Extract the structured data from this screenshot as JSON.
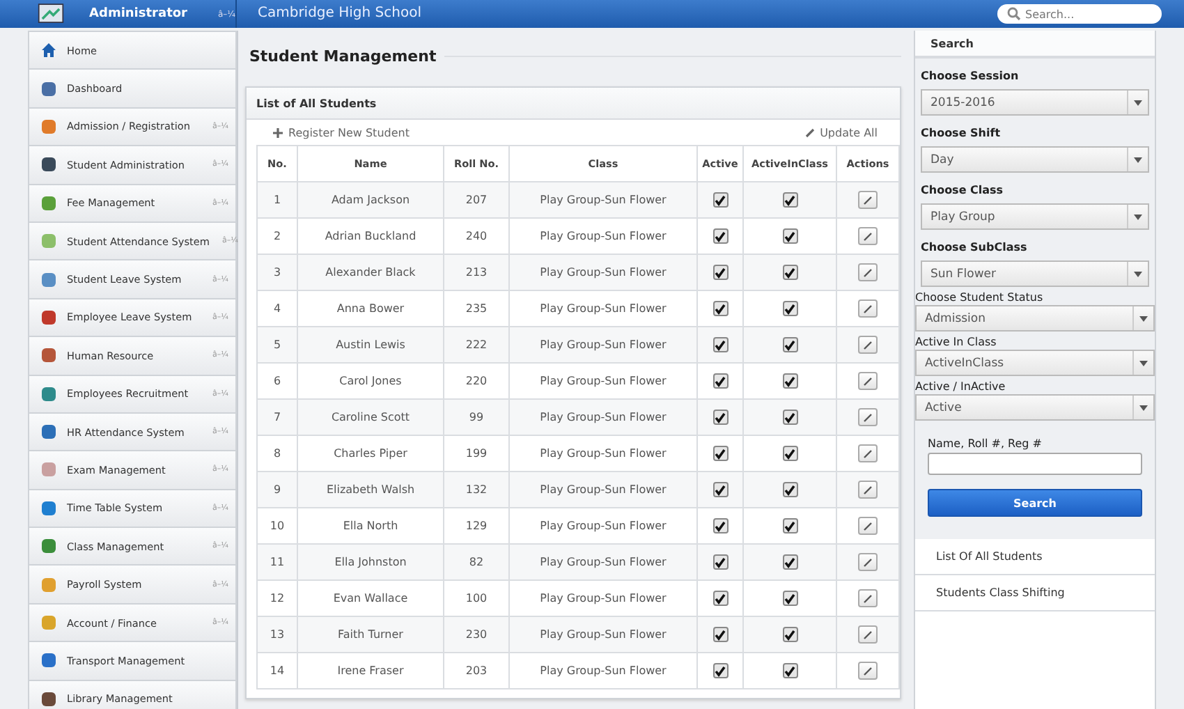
{
  "header": {
    "user": "Administrator",
    "user_caret": "â–¼",
    "school": "Cambridge High School",
    "search_placeholder": "Search..."
  },
  "sidebar": {
    "items": [
      {
        "label": "Home",
        "selected": false
      },
      {
        "label": "Dashboard",
        "selected": false
      },
      {
        "label": "Admission / Registration",
        "caret": "â–¼",
        "selected": false
      },
      {
        "label": "Student Administration",
        "caret": "â–¼",
        "selected": false
      },
      {
        "label": "Fee Management",
        "caret": "â–¼",
        "selected": false
      },
      {
        "label": "Student Attendance System",
        "caret": "â–¼",
        "selected": false
      },
      {
        "label": "Student Leave System",
        "caret": "â–¼",
        "selected": false
      },
      {
        "label": "Employee Leave System",
        "caret": "â–¼",
        "selected": false
      },
      {
        "label": "Human Resource",
        "caret": "â–¼",
        "selected": false
      },
      {
        "label": "Employees Recruitment",
        "caret": "â–¼",
        "selected": false
      },
      {
        "label": "HR Attendance System",
        "caret": "â–¼",
        "selected": false
      },
      {
        "label": "Exam Management",
        "caret": "â–¼",
        "selected": false
      },
      {
        "label": "Time Table System",
        "caret": "â–¼",
        "selected": false
      },
      {
        "label": "Class Management",
        "caret": "â–¼",
        "selected": false
      },
      {
        "label": "Payroll System",
        "caret": "â–¼",
        "selected": false
      },
      {
        "label": "Account / Finance",
        "caret": "â–¼",
        "selected": false
      },
      {
        "label": "Transport Management",
        "selected": false
      },
      {
        "label": "Library Management",
        "selected": false
      }
    ]
  },
  "page_title": "Student Management",
  "panel": {
    "title": "List of All Students",
    "register": "Register New Student",
    "update_all": "Update All",
    "table": {
      "columns": [
        "No.",
        "Name",
        "Roll No.",
        "Class",
        "Active",
        "ActiveInClass",
        "Actions"
      ],
      "rows": [
        {
          "no": "1",
          "name": "Adam Jackson",
          "roll": "207",
          "class": "Play Group-Sun Flower",
          "active": true,
          "active_in_class": true
        },
        {
          "no": "2",
          "name": "Adrian Buckland",
          "roll": "240",
          "class": "Play Group-Sun Flower",
          "active": true,
          "active_in_class": true
        },
        {
          "no": "3",
          "name": "Alexander Black",
          "roll": "213",
          "class": "Play Group-Sun Flower",
          "active": true,
          "active_in_class": true
        },
        {
          "no": "4",
          "name": "Anna Bower",
          "roll": "235",
          "class": "Play Group-Sun Flower",
          "active": true,
          "active_in_class": true
        },
        {
          "no": "5",
          "name": "Austin Lewis",
          "roll": "222",
          "class": "Play Group-Sun Flower",
          "active": true,
          "active_in_class": true
        },
        {
          "no": "6",
          "name": "Carol Jones",
          "roll": "220",
          "class": "Play Group-Sun Flower",
          "active": true,
          "active_in_class": true
        },
        {
          "no": "7",
          "name": "Caroline Scott",
          "roll": "99",
          "class": "Play Group-Sun Flower",
          "active": true,
          "active_in_class": true
        },
        {
          "no": "8",
          "name": "Charles Piper",
          "roll": "199",
          "class": "Play Group-Sun Flower",
          "active": true,
          "active_in_class": true
        },
        {
          "no": "9",
          "name": "Elizabeth Walsh",
          "roll": "132",
          "class": "Play Group-Sun Flower",
          "active": true,
          "active_in_class": true
        },
        {
          "no": "10",
          "name": "Ella North",
          "roll": "129",
          "class": "Play Group-Sun Flower",
          "active": true,
          "active_in_class": true
        },
        {
          "no": "11",
          "name": "Ella Johnston",
          "roll": "82",
          "class": "Play Group-Sun Flower",
          "active": true,
          "active_in_class": true
        },
        {
          "no": "12",
          "name": "Evan Wallace",
          "roll": "100",
          "class": "Play Group-Sun Flower",
          "active": true,
          "active_in_class": true
        },
        {
          "no": "13",
          "name": "Faith Turner",
          "roll": "230",
          "class": "Play Group-Sun Flower",
          "active": true,
          "active_in_class": true
        },
        {
          "no": "14",
          "name": "Irene Fraser",
          "roll": "203",
          "class": "Play Group-Sun Flower",
          "active": true,
          "active_in_class": true
        }
      ]
    }
  },
  "search_panel": {
    "title": "Search",
    "filters": [
      {
        "label": "Choose Session",
        "value": "2015-2016",
        "kind": "inset"
      },
      {
        "label": "Choose Shift",
        "value": "Day",
        "kind": "inset"
      },
      {
        "label": "Choose Class",
        "value": "Play Group",
        "kind": "inset"
      },
      {
        "label": "Choose SubClass",
        "value": "Sun Flower",
        "kind": "inset"
      },
      {
        "label": "Choose Student Status",
        "value": "Admission",
        "kind": "wide"
      },
      {
        "label": "Active In Class",
        "value": "ActiveInClass",
        "kind": "wide"
      },
      {
        "label": "Active / InActive",
        "value": "Active",
        "kind": "wide"
      }
    ],
    "text_label": "Name, Roll #, Reg #",
    "button": "Search",
    "links": [
      "List Of All Students",
      "Students Class Shifting"
    ]
  }
}
